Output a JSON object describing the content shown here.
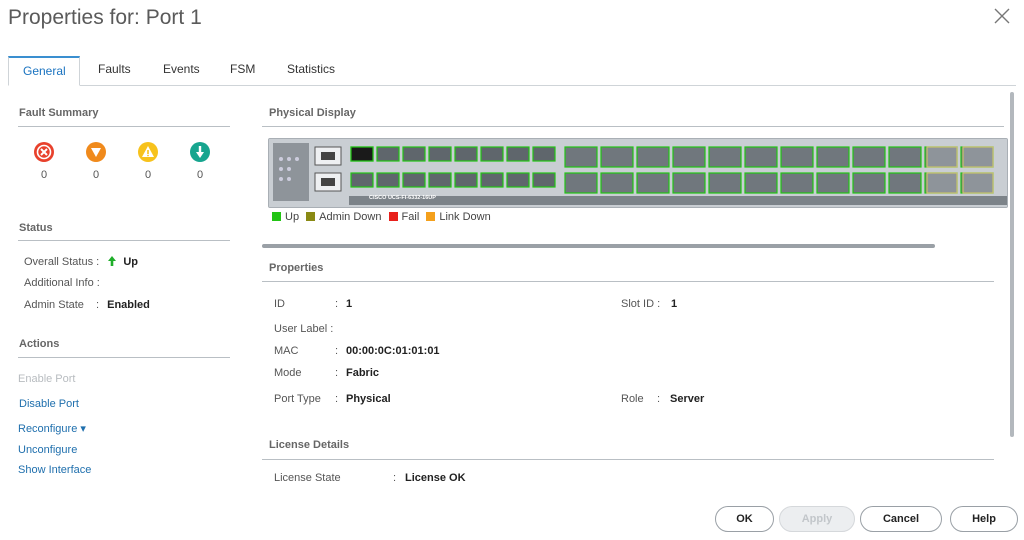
{
  "dialog": {
    "title": "Properties for: Port 1"
  },
  "tabs": [
    {
      "label": "General"
    },
    {
      "label": "Faults"
    },
    {
      "label": "Events"
    },
    {
      "label": "FSM"
    },
    {
      "label": "Statistics"
    }
  ],
  "fault_summary": {
    "heading": "Fault Summary",
    "items": [
      {
        "icon": "critical-x-icon",
        "color": "#e8412c",
        "count": "0"
      },
      {
        "icon": "major-down-arrow-icon",
        "color": "#f08a1c",
        "count": "0"
      },
      {
        "icon": "minor-warning-icon",
        "color": "#f7c21c",
        "count": "0"
      },
      {
        "icon": "warning-down-icon",
        "color": "#17a58f",
        "count": "0"
      }
    ]
  },
  "status": {
    "heading": "Status",
    "overall_status_label": "Overall Status :",
    "overall_status_value": "Up",
    "additional_info_label": "Additional Info :",
    "admin_state_label": "Admin State",
    "admin_state_sep": ":",
    "admin_state_value": "Enabled"
  },
  "actions": {
    "heading": "Actions",
    "items": [
      {
        "label": "Enable Port",
        "enabled": false
      },
      {
        "label": "Disable Port",
        "enabled": true
      },
      {
        "label": "Reconfigure ▾",
        "enabled": true
      },
      {
        "label": "Unconfigure",
        "enabled": true
      },
      {
        "label": "Show Interface",
        "enabled": true
      }
    ]
  },
  "physical_display": {
    "heading": "Physical Display",
    "device_label": "CISCO UCS-FI-6332-16UP",
    "legend": [
      {
        "label": "Up",
        "color": "#22c414"
      },
      {
        "label": "Admin Down",
        "color": "#8a8a14"
      },
      {
        "label": "Fail",
        "color": "#e8201c"
      },
      {
        "label": "Link Down",
        "color": "#f4a01c"
      }
    ]
  },
  "properties": {
    "heading": "Properties",
    "id_label": "ID",
    "id_value": "1",
    "slot_label": "Slot ID :",
    "slot_value": "1",
    "user_label_label": "User Label :",
    "mac_label": "MAC",
    "mac_value": "00:00:0C:01:01:01",
    "mode_label": "Mode",
    "mode_value": "Fabric",
    "port_type_label": "Port Type",
    "port_type_value": "Physical",
    "role_label": "Role",
    "role_value": "Server",
    "sep": ":"
  },
  "license": {
    "heading": "License Details",
    "state_label": "License State",
    "state_value": "License OK",
    "sep": ":"
  },
  "buttons": {
    "ok": "OK",
    "apply": "Apply",
    "cancel": "Cancel",
    "help": "Help"
  }
}
